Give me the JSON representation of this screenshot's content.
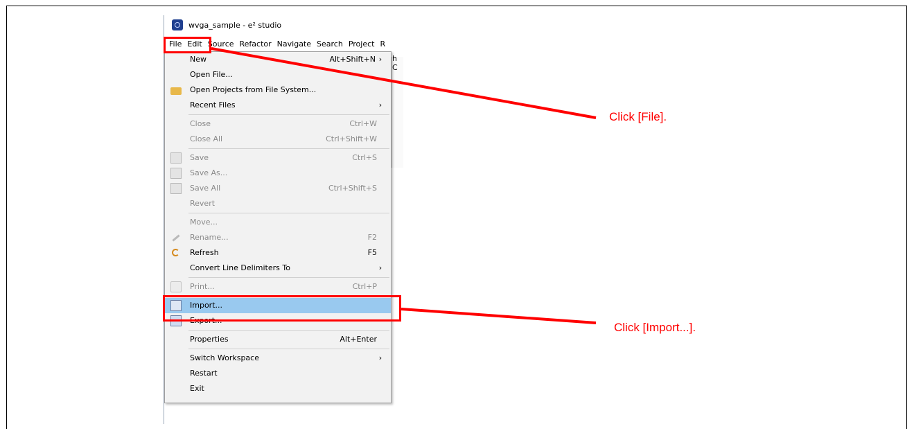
{
  "window": {
    "title": "wvga_sample - e² studio"
  },
  "menubar": [
    "File",
    "Edit",
    "Source",
    "Refactor",
    "Navigate",
    "Search",
    "Project",
    "R"
  ],
  "toolbar_fragment": "h C",
  "file_menu": [
    {
      "label": "New",
      "shortcut": "Alt+Shift+N",
      "submenu": true,
      "disabled": false,
      "icon": ""
    },
    {
      "label": "Open File...",
      "shortcut": "",
      "submenu": false,
      "disabled": false,
      "icon": ""
    },
    {
      "label": "Open Projects from File System...",
      "shortcut": "",
      "submenu": false,
      "disabled": false,
      "icon": "folder-icon"
    },
    {
      "label": "Recent Files",
      "shortcut": "",
      "submenu": true,
      "disabled": false,
      "icon": ""
    },
    {
      "separator": true
    },
    {
      "label": "Close",
      "shortcut": "Ctrl+W",
      "submenu": false,
      "disabled": true,
      "icon": ""
    },
    {
      "label": "Close All",
      "shortcut": "Ctrl+Shift+W",
      "submenu": false,
      "disabled": true,
      "icon": ""
    },
    {
      "separator": true
    },
    {
      "label": "Save",
      "shortcut": "Ctrl+S",
      "submenu": false,
      "disabled": true,
      "icon": "save-icon"
    },
    {
      "label": "Save As...",
      "shortcut": "",
      "submenu": false,
      "disabled": true,
      "icon": "save-as-icon"
    },
    {
      "label": "Save All",
      "shortcut": "Ctrl+Shift+S",
      "submenu": false,
      "disabled": true,
      "icon": "save-all-icon"
    },
    {
      "label": "Revert",
      "shortcut": "",
      "submenu": false,
      "disabled": true,
      "icon": ""
    },
    {
      "separator": true
    },
    {
      "label": "Move...",
      "shortcut": "",
      "submenu": false,
      "disabled": true,
      "icon": ""
    },
    {
      "label": "Rename...",
      "shortcut": "F2",
      "submenu": false,
      "disabled": true,
      "icon": "rename-icon"
    },
    {
      "label": "Refresh",
      "shortcut": "F5",
      "submenu": false,
      "disabled": false,
      "icon": "refresh-icon"
    },
    {
      "label": "Convert Line Delimiters To",
      "shortcut": "",
      "submenu": true,
      "disabled": false,
      "icon": ""
    },
    {
      "separator": true
    },
    {
      "label": "Print...",
      "shortcut": "Ctrl+P",
      "submenu": false,
      "disabled": true,
      "icon": "print-icon"
    },
    {
      "separator": true
    },
    {
      "label": "Import...",
      "shortcut": "",
      "submenu": false,
      "disabled": false,
      "icon": "import-icon",
      "highlighted": true
    },
    {
      "label": "Export...",
      "shortcut": "",
      "submenu": false,
      "disabled": false,
      "icon": "export-icon"
    },
    {
      "separator": true
    },
    {
      "label": "Properties",
      "shortcut": "Alt+Enter",
      "submenu": false,
      "disabled": false,
      "icon": ""
    },
    {
      "separator": true
    },
    {
      "label": "Switch Workspace",
      "shortcut": "",
      "submenu": true,
      "disabled": false,
      "icon": ""
    },
    {
      "label": "Restart",
      "shortcut": "",
      "submenu": false,
      "disabled": false,
      "icon": ""
    },
    {
      "label": "Exit",
      "shortcut": "",
      "submenu": false,
      "disabled": false,
      "icon": ""
    }
  ],
  "annotations": {
    "file": "Click [File].",
    "import": "Click [Import...]."
  },
  "colors": {
    "annotation": "#ff0000",
    "highlight": "#99c9ef"
  }
}
